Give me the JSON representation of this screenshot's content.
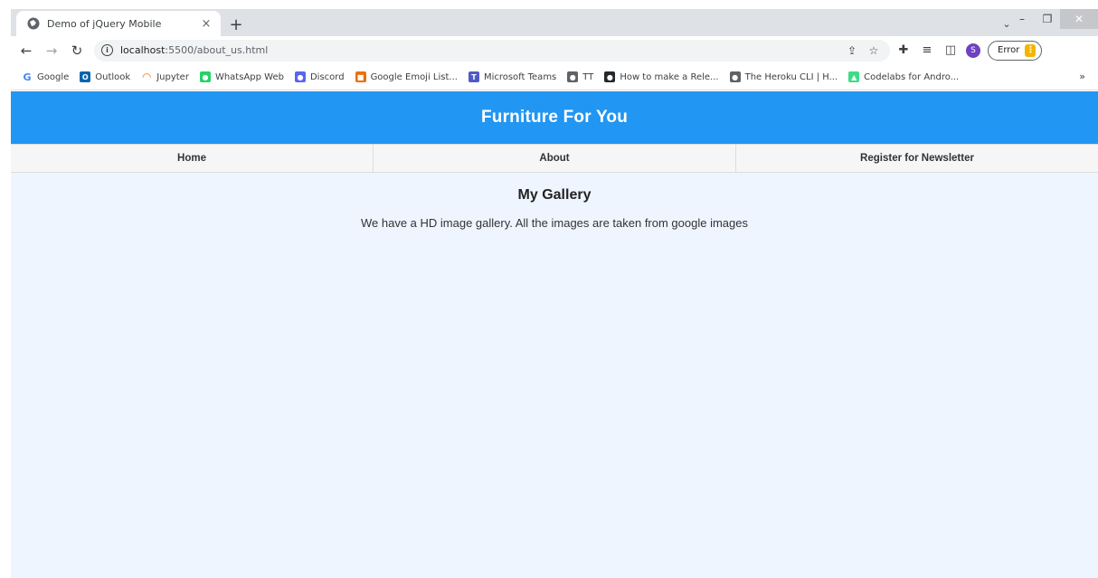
{
  "browser": {
    "tab_title": "Demo of jQuery Mobile",
    "tab_close": "×",
    "new_tab": "+",
    "url_host": "localhost",
    "url_path": ":5500/about_us.html",
    "error_label": "Error",
    "profile_initial": "S",
    "more_bookmarks": "»"
  },
  "bookmarks": [
    {
      "label": "Google",
      "icon": "google-icon",
      "color": "#4285f4",
      "glyph": "G"
    },
    {
      "label": "Outlook",
      "icon": "outlook-icon",
      "color": "#0a64ad",
      "glyph": "O"
    },
    {
      "label": "Jupyter",
      "icon": "jupyter-icon",
      "color": "#f37626",
      "glyph": "◠"
    },
    {
      "label": "WhatsApp Web",
      "icon": "whatsapp-icon",
      "color": "#25d366",
      "glyph": "●"
    },
    {
      "label": "Discord",
      "icon": "discord-icon",
      "color": "#5865f2",
      "glyph": "●"
    },
    {
      "label": "Google Emoji List...",
      "icon": "emoji-icon",
      "color": "#e8710a",
      "glyph": "■"
    },
    {
      "label": "Microsoft Teams",
      "icon": "teams-icon",
      "color": "#5059c9",
      "glyph": "T"
    },
    {
      "label": "TT",
      "icon": "globe-icon",
      "color": "#5f6368",
      "glyph": "●"
    },
    {
      "label": "How to make a Rele...",
      "icon": "github-icon",
      "color": "#24292e",
      "glyph": "●"
    },
    {
      "label": "The Heroku CLI | H...",
      "icon": "globe-icon",
      "color": "#5f6368",
      "glyph": "●"
    },
    {
      "label": "Codelabs for Andro...",
      "icon": "android-icon",
      "color": "#3ddc84",
      "glyph": "▲"
    }
  ],
  "page": {
    "header_title": "Furniture For You",
    "nav": [
      "Home",
      "About",
      "Register for Newsletter"
    ],
    "gallery_title": "My Gallery",
    "gallery_text": "We have a HD image gallery. All the images are taken from google images"
  },
  "colors": {
    "header": "#2196f3",
    "page_bg": "#eef5ff"
  }
}
